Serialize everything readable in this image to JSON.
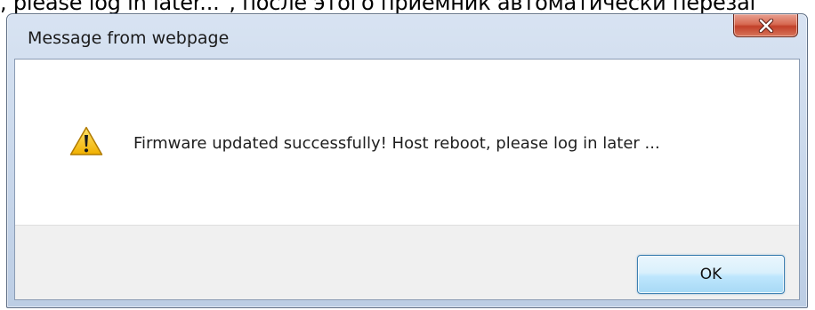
{
  "background_text": ", please log in later...\", после этого приемник автоматически перезаг",
  "dialog": {
    "title": "Message from webpage",
    "close_icon": "close-icon",
    "message_icon": "warning-icon",
    "message": "Firmware updated successfully! Host reboot, please log in later ...",
    "ok_label": "OK"
  },
  "colors": {
    "title_bar": "#c7d6ea",
    "close_button": "#c2402a",
    "ok_button_border": "#3c7fb1",
    "button_area": "#f0f0f0",
    "warning_fill": "#f5c518"
  }
}
